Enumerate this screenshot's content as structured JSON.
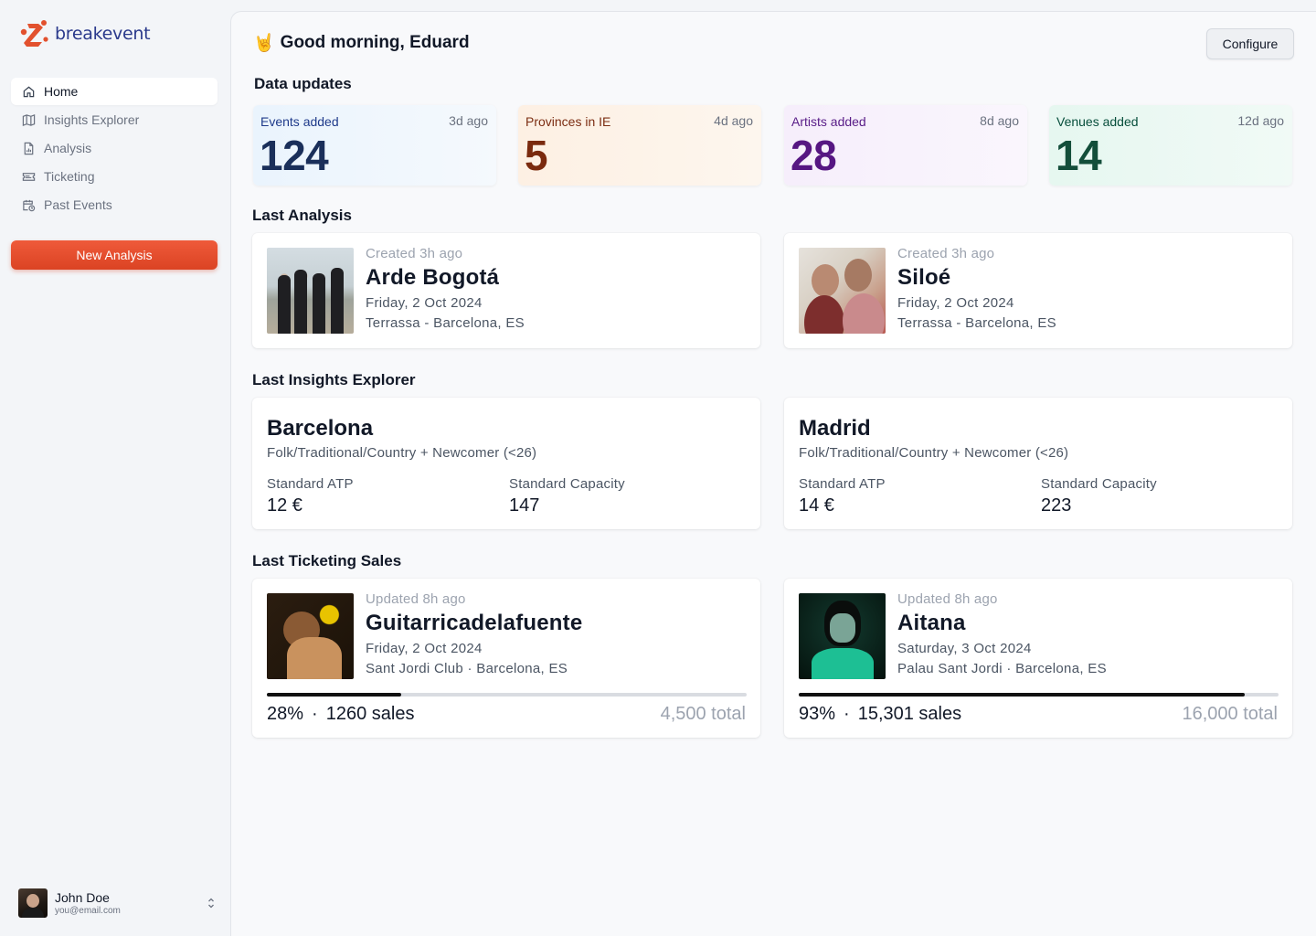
{
  "brand": {
    "name": "breakevent",
    "accent": "#e2512e"
  },
  "sidebar": {
    "items": [
      {
        "label": "Home",
        "icon": "home-icon",
        "active": true
      },
      {
        "label": "Insights Explorer",
        "icon": "map-icon",
        "active": false
      },
      {
        "label": "Analysis",
        "icon": "document-chart-icon",
        "active": false
      },
      {
        "label": "Ticketing",
        "icon": "ticket-icon",
        "active": false
      },
      {
        "label": "Past Events",
        "icon": "calendar-clock-icon",
        "active": false
      }
    ],
    "new_analysis_label": "New Analysis",
    "user": {
      "name": "John Doe",
      "email": "you@email.com"
    }
  },
  "header": {
    "greeting_icon": "🤘",
    "greeting": "Good morning, Eduard",
    "configure_label": "Configure"
  },
  "data_updates": {
    "title": "Data updates",
    "cards": [
      {
        "label": "Events added",
        "ago": "3d ago",
        "value": "124",
        "color": "#1a2f5a"
      },
      {
        "label": "Provinces in IE",
        "ago": "4d ago",
        "value": "5",
        "color": "#7a2a0e"
      },
      {
        "label": "Artists added",
        "ago": "8d ago",
        "value": "28",
        "color": "#561682"
      },
      {
        "label": "Venues added",
        "ago": "12d ago",
        "value": "14",
        "color": "#134e3a"
      }
    ]
  },
  "last_analysis": {
    "title": "Last Analysis",
    "items": [
      {
        "meta": "Created 3h ago",
        "artist": "Arde Bogotá",
        "date": "Friday, 2 Oct 2024",
        "location": "Terrassa - Barcelona, ES"
      },
      {
        "meta": "Created 3h ago",
        "artist": "Siloé",
        "date": "Friday, 2 Oct 2024",
        "location": "Terrassa - Barcelona, ES"
      }
    ]
  },
  "last_insights": {
    "title": "Last Insights Explorer",
    "items": [
      {
        "city": "Barcelona",
        "segment": "Folk/Traditional/Country + Newcomer (<26)",
        "atp_label": "Standard ATP",
        "atp": "12 €",
        "capacity_label": "Standard Capacity",
        "capacity": "147"
      },
      {
        "city": "Madrid",
        "segment": "Folk/Traditional/Country + Newcomer (<26)",
        "atp_label": "Standard ATP",
        "atp": "14 €",
        "capacity_label": "Standard Capacity",
        "capacity": "223"
      }
    ]
  },
  "last_ticketing": {
    "title": "Last Ticketing Sales",
    "items": [
      {
        "meta": "Updated 8h ago",
        "artist": "Guitarricadelafuente",
        "date": "Friday, 2 Oct 2024",
        "location": "Sant Jordi Club · Barcelona, ES",
        "percent": "28%",
        "progress": 0.28,
        "sales": "1260 sales",
        "total": "4,500 total"
      },
      {
        "meta": "Updated 8h ago",
        "artist": "Aitana",
        "date": "Saturday, 3 Oct 2024",
        "location": "Palau Sant Jordi · Barcelona, ES",
        "percent": "93%",
        "progress": 0.93,
        "sales": "15,301 sales",
        "total": "16,000 total"
      }
    ]
  }
}
